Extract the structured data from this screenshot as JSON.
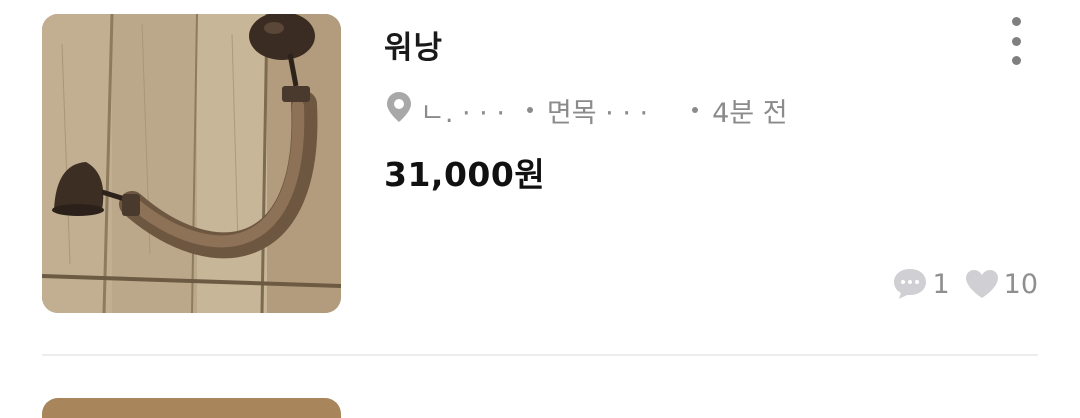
{
  "listing": {
    "image_alt": "antique wooden tool with iron caps",
    "title": "워낭",
    "location_short": "ㄴ. · · ·",
    "category_short": "면목 · · ·",
    "posted_time": "4분 전",
    "price": "31,000원",
    "comments_count": "1",
    "likes_count": "10",
    "icons": {
      "more": "more-vertical-icon",
      "location": "location-pin-icon",
      "comment": "chat-bubble-icon",
      "like": "heart-icon"
    }
  },
  "colors": {
    "text_primary": "#111111",
    "text_secondary": "#8b8b8b",
    "icon_gray": "#cfcfd4",
    "divider": "#ededed"
  }
}
